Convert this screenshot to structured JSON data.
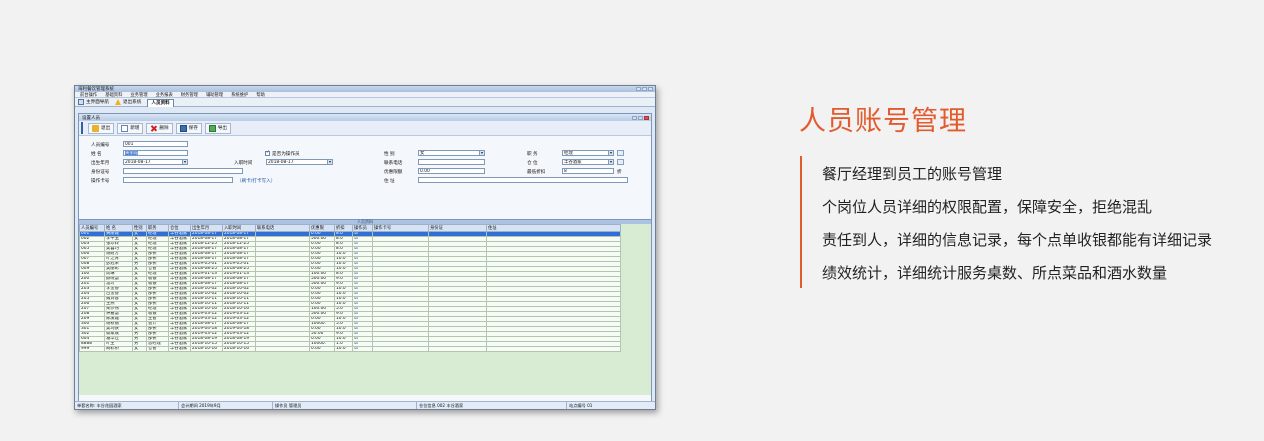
{
  "heading": "人员账号管理",
  "accent_color": "#e35a2d",
  "descriptions": [
    "餐厅经理到员工的账号管理",
    "个岗位人员详细的权限配置，保障安全，拒绝混乱",
    "责任到人，详细的信息记录，每个点单收银都能有详细记录",
    "绩效统计，详细统计服务桌数、所点菜品和酒水数量"
  ],
  "app": {
    "title": "海利餐饮管理系统",
    "menu": [
      "前台操作",
      "基础资料",
      "业务管理",
      "业务报表",
      "财务管理",
      "辅助管理",
      "系统维护",
      "帮助"
    ],
    "tabs": [
      {
        "label": "主界面导航",
        "icon": "home-icon"
      },
      {
        "label": "退出系统",
        "icon": "warning-icon"
      },
      {
        "label": "人员资料",
        "active": true
      }
    ],
    "inner_title": "设置人员",
    "toolbar": [
      {
        "label": "退出",
        "icon": "exit-icon"
      },
      {
        "label": "新增",
        "icon": "add-icon"
      },
      {
        "label": "删除",
        "icon": "delete-icon"
      },
      {
        "label": "保存",
        "icon": "save-icon"
      },
      {
        "label": "导出",
        "icon": "export-icon"
      }
    ],
    "form": {
      "emp_no_label": "人员编号",
      "emp_no_value": "001",
      "name_label": "姓  名",
      "name_value": "黄丽霞",
      "birth_label": "出生年月",
      "birth_value": "2018-08-17",
      "id_label": "身份证号",
      "id_value": "",
      "card_label": "操作卡号",
      "card_value": "",
      "is_operator_label": "是否为操作员",
      "join_label": "入职时间",
      "join_value": "2018-08-17",
      "card_note": "（刷卡/打卡写入）",
      "gender_label": "性  别",
      "gender_value": "女",
      "phone_label": "联系电话",
      "phone_value": "",
      "discount_limit_label": "优惠限额",
      "discount_limit_value": "0.00",
      "address_label": "住  址",
      "address_value": "",
      "position_label": "职  务",
      "position_value": "经理",
      "store_label": "仓  位",
      "store_value": "丰谷酒家",
      "min_discount_label": "最低折扣",
      "min_discount_value": "8",
      "discount_unit": "折"
    },
    "grid_caption": "人员资料",
    "grid_headers": [
      "人员编号",
      "姓 名",
      "性别",
      "职务",
      "仓位",
      "出生年月",
      "入职时间",
      "联系电话",
      "优惠限",
      "折扣",
      "操作员",
      "操作卡号",
      "身份证",
      "住址"
    ],
    "grid_rows": [
      [
        "001",
        "黄丽霞",
        "女",
        "经理",
        "丰谷酒家",
        "2018-08-17",
        "2018-08-17",
        "",
        "0.00",
        "8.0"
      ],
      [
        "002",
        "李平玉",
        "女",
        "经理",
        "丰谷酒家",
        "2018-08-17",
        "2018-08-17",
        "",
        "500.00",
        "8.0"
      ],
      [
        "003",
        "张珍转",
        "女",
        "经理",
        "丰谷酒家",
        "2018-12-25",
        "2018-12-25",
        "",
        "0.00",
        "8.0"
      ],
      [
        "005",
        "吴喜巧",
        "女",
        "经理",
        "丰谷酒家",
        "2018-08-17",
        "2018-08-17",
        "",
        "0.00",
        "8.0"
      ],
      [
        "006",
        "谢耐芳",
        "女",
        "部长",
        "丰谷酒家",
        "2018-08-17",
        "2018-08-17",
        "",
        "0.00",
        "10.0"
      ],
      [
        "007",
        "叶芝青",
        "女",
        "部长",
        "丰谷酒家",
        "2018-08-17",
        "2018-08-17",
        "",
        "0.00",
        "10.0"
      ],
      [
        "008",
        "彭冠荣",
        "男",
        "部长",
        "丰谷酒家",
        "2019-05-01",
        "2019-05-01",
        "",
        "0.00",
        "10.0"
      ],
      [
        "009",
        "吴丽彩",
        "女",
        "仓管",
        "丰谷酒家",
        "2018-08-25",
        "2018-08-25",
        "",
        "0.00",
        "10.0"
      ],
      [
        "100",
        "周琳",
        "女",
        "经理",
        "丰谷酒家",
        "2019-01-13",
        "2019-01-13",
        "",
        "100.00",
        "8.0"
      ],
      [
        "200",
        "颜晓慧",
        "女",
        "收银",
        "丰谷酒家",
        "2018-08-17",
        "2018-08-17",
        "",
        "500.00",
        "9.0"
      ],
      [
        "201",
        "温玲",
        "女",
        "收银",
        "丰谷酒家",
        "2018-08-17",
        "2018-08-17",
        "",
        "500.00",
        "9.0"
      ],
      [
        "203",
        "李金香",
        "女",
        "部长",
        "丰谷酒家",
        "2018-10-02",
        "2018-10-02",
        "",
        "0.00",
        "10.0"
      ],
      [
        "204",
        "古金香",
        "女",
        "部长",
        "丰谷酒家",
        "2018-10-02",
        "2018-10-02",
        "",
        "0.00",
        "10.0"
      ],
      [
        "205",
        "魏诗蓉",
        "女",
        "部长",
        "丰谷酒家",
        "2018-10-11",
        "2018-10-11",
        "",
        "0.00",
        "10.0"
      ],
      [
        "206",
        "王燕",
        "女",
        "部长",
        "丰谷酒家",
        "2018-10-11",
        "2018-10-11",
        "",
        "0.00",
        "10.0"
      ],
      [
        "207",
        "梁沙燕",
        "女",
        "经理",
        "丰谷酒家",
        "2018-10-16",
        "2018-10-16",
        "",
        "100.00",
        "5.0"
      ],
      [
        "208",
        "钟嘉慧",
        "女",
        "收银",
        "丰谷酒家",
        "2019-03-12",
        "2019-03-12",
        "",
        "500.00",
        "9.0"
      ],
      [
        "209",
        "陈凌霞",
        "女",
        "主管",
        "丰谷酒家",
        "2019-03-12",
        "2019-03-12",
        "",
        "0.00",
        "10.0"
      ],
      [
        "300",
        "谢秋丽",
        "女",
        "会计",
        "丰谷酒家",
        "2018-08-17",
        "2018-08-17",
        "",
        "10000.",
        "5.0"
      ],
      [
        "301",
        "吴玛侠",
        "女",
        "部长",
        "丰谷酒家",
        "2019-04-18",
        "2019-04-18",
        "",
        "0.00",
        "10.0"
      ],
      [
        "302",
        "蔡家成",
        "男",
        "部长",
        "丰谷酒家",
        "2019-03-12",
        "2019-03-12",
        "",
        "50.00",
        "9.0"
      ],
      [
        "604",
        "潘华佳",
        "男",
        "部长",
        "丰谷酒家",
        "2018-08-19",
        "2018-08-19",
        "",
        "0.00",
        "10.0"
      ],
      [
        "8888",
        "叶生",
        "男",
        "总经理",
        "丰谷酒家",
        "2018-10-15",
        "2018-10-15",
        "",
        "10000.",
        "1.0"
      ],
      [
        "999",
        "胡彩桥",
        "女",
        "仓管",
        "丰谷酒家",
        "2018-10-16",
        "2018-10-16",
        "",
        "0.00",
        "10.0"
      ]
    ],
    "status": {
      "shop": "单套名称:  丰谷花园酒家",
      "date": "会计期间  2019年9月",
      "operator": "操作员    管理员",
      "warehouse": "仓位信息   002 丰谷酒家",
      "station": "站点编号  01"
    }
  }
}
